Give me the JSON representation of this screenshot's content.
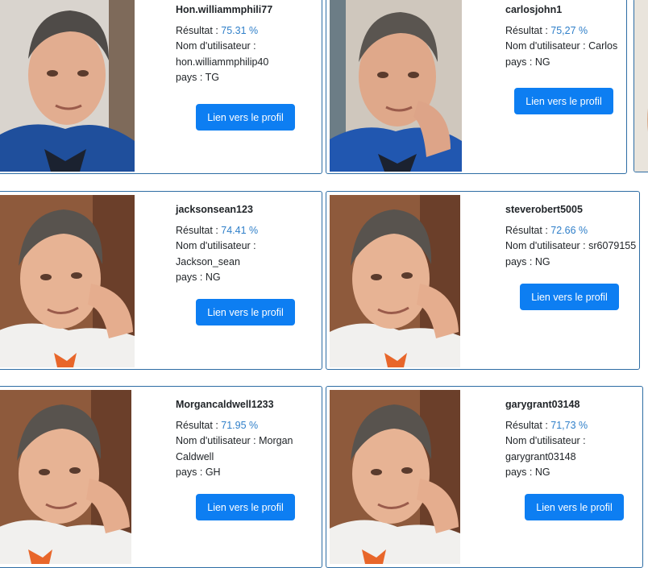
{
  "labels": {
    "score": "Résultat : ",
    "username": "Nom d'utilisateur : ",
    "country": "pays : "
  },
  "cards": [
    {
      "title": "Hon.williammphili77",
      "score": "75.31 %",
      "username_line1": "",
      "username_line2": "hon.williammphilip40",
      "country": "TG",
      "button": "Lien vers le profil"
    },
    {
      "title": "carlosjohn1",
      "score": "75,27 %",
      "username_line1": "Carlos",
      "username_line2": "",
      "country": "NG",
      "button": "Lien vers le profil"
    },
    {
      "title": "jacksonsean123",
      "score": "74.41 %",
      "username_line1": "",
      "username_line2": "Jackson_sean",
      "country": "NG",
      "button": "Lien vers le profil"
    },
    {
      "title": "steverobert5005",
      "score": "72.66 %",
      "username_line1": "sr6079155",
      "username_line2": "",
      "country": "NG",
      "button": "Lien vers le profil"
    },
    {
      "title": "Morgancaldwell1233",
      "score": "71.95 %",
      "username_line1": "Morgan",
      "username_line2": "Caldwell",
      "country": "GH",
      "button": "Lien vers le profil"
    },
    {
      "title": "garygrant03148",
      "score": "71,73 %",
      "username_line1": "",
      "username_line2": "garygrant03148",
      "country": "NG",
      "button": "Lien vers le profil"
    }
  ],
  "colors": {
    "accent": "#0d7ef2",
    "score": "#2f7fc9",
    "border": "#2e6da4"
  }
}
